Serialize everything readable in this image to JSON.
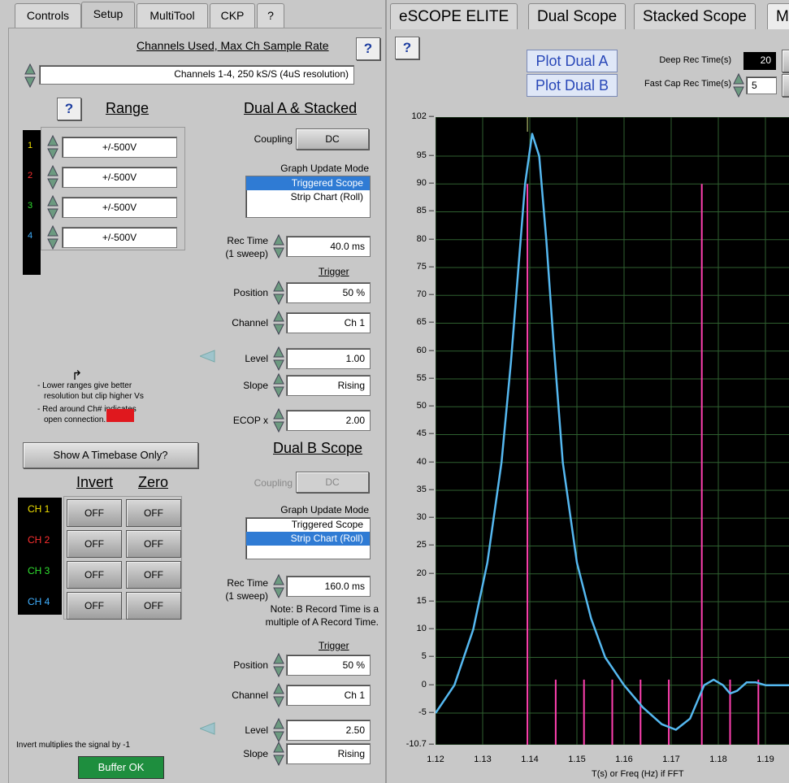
{
  "left_tabs": [
    "Controls",
    "Setup",
    "MultiTool",
    "CKP",
    "?"
  ],
  "right_tabs": [
    "eSCOPE ELITE",
    "Dual Scope",
    "Stacked Scope",
    "M"
  ],
  "channels_used": {
    "title": "Channels Used, Max Ch Sample Rate",
    "value": "Channels 1-4, 250 kS/S (4uS resolution)",
    "help": "?"
  },
  "range": {
    "title": "Range",
    "help": "?",
    "channels": [
      {
        "num": "1",
        "value": "+/-500V",
        "color": "#f0e000"
      },
      {
        "num": "2",
        "value": "+/-500V",
        "color": "#ff3030"
      },
      {
        "num": "3",
        "value": "+/-500V",
        "color": "#30e030"
      },
      {
        "num": "4",
        "value": "+/-500V",
        "color": "#40b0ff"
      }
    ]
  },
  "notes": {
    "line1": "- Lower ranges give better",
    "line2": "  resolution but clip higher Vs",
    "line3": "- Red around Ch# indicates",
    "line4": "  open connection."
  },
  "timebase_button": "Show A Timebase Only?",
  "invert_zero": {
    "invert_title": "Invert",
    "zero_title": "Zero",
    "rows": [
      {
        "label": "CH 1",
        "color": "#f0e000",
        "invert": "OFF",
        "zero": "OFF"
      },
      {
        "label": "CH 2",
        "color": "#ff3030",
        "invert": "OFF",
        "zero": "OFF"
      },
      {
        "label": "CH 3",
        "color": "#30e030",
        "invert": "OFF",
        "zero": "OFF"
      },
      {
        "label": "CH 4",
        "color": "#40b0ff",
        "invert": "OFF",
        "zero": "OFF"
      }
    ]
  },
  "invert_note": "Invert multiplies the signal by -1",
  "buffer_status": "Buffer OK",
  "dual_a": {
    "title": "Dual A & Stacked",
    "coupling_label": "Coupling",
    "coupling": "DC",
    "update_mode_label": "Graph Update Mode",
    "modes": [
      "Triggered Scope",
      "Strip Chart (Roll)"
    ],
    "selected_mode": 0,
    "rec_time_label": "Rec Time",
    "rec_time_sub": "(1 sweep)",
    "rec_time": "40.0 ms",
    "trigger_label": "Trigger",
    "position_label": "Position",
    "position": "50 %",
    "channel_label": "Channel",
    "channel": "Ch 1",
    "level_label": "Level",
    "level": "1.00",
    "slope_label": "Slope",
    "slope": "Rising",
    "ecop_label": "ECOP x",
    "ecop": "2.00"
  },
  "dual_b": {
    "title": "Dual B Scope",
    "coupling_label": "Coupling",
    "coupling": "DC",
    "update_mode_label": "Graph Update Mode",
    "modes": [
      "Triggered Scope",
      "Strip Chart (Roll)"
    ],
    "selected_mode": 1,
    "rec_time_label": "Rec Time",
    "rec_time_sub": "(1 sweep)",
    "rec_time": "160.0 ms",
    "note1": "Note: B Record Time is a",
    "note2": "multiple of A Record Time.",
    "trigger_label": "Trigger",
    "position_label": "Position",
    "position": "50 %",
    "channel_label": "Channel",
    "channel": "Ch 1",
    "level_label": "Level",
    "level": "2.50",
    "slope_label": "Slope",
    "slope": "Rising"
  },
  "right_header": {
    "help": "?",
    "plot_a": "Plot Dual A",
    "plot_b": "Plot Dual B",
    "deep_rec_label": "Deep Rec Time(s)",
    "deep_rec_value": "20",
    "fast_cap_label": "Fast Cap Rec Time(s)",
    "fast_cap_value": "5"
  },
  "chart_data": {
    "type": "line",
    "xlabel": "T(s) or Freq (Hz) if FFT",
    "xlim": [
      1.12,
      1.195
    ],
    "ylim": [
      -10.7,
      102
    ],
    "x_ticks": [
      "1.12",
      "1.13",
      "1.14",
      "1.15",
      "1.16",
      "1.17",
      "1.18",
      "1.19"
    ],
    "y_ticks": [
      "102",
      "95",
      "90",
      "85",
      "80",
      "75",
      "70",
      "65",
      "60",
      "55",
      "50",
      "45",
      "40",
      "35",
      "30",
      "25",
      "20",
      "15",
      "10",
      "5",
      "0",
      "-5",
      "-10.7"
    ],
    "cursor_label": "1",
    "series": [
      {
        "color": "#55b8f0",
        "x": [
          1.12,
          1.124,
          1.128,
          1.131,
          1.134,
          1.136,
          1.1375,
          1.139,
          1.1405,
          1.142,
          1.1435,
          1.145,
          1.147,
          1.15,
          1.153,
          1.156,
          1.16,
          1.164,
          1.168,
          1.171,
          1.174,
          1.177,
          1.179,
          1.181,
          1.1825,
          1.184,
          1.186,
          1.188,
          1.19,
          1.193,
          1.195
        ],
        "y": [
          -5,
          0,
          10,
          22,
          40,
          58,
          74,
          90,
          99,
          95,
          80,
          62,
          40,
          22,
          12,
          5,
          0,
          -4,
          -7,
          -8,
          -6,
          0,
          1,
          0,
          -1.5,
          -1,
          0.5,
          0.5,
          0,
          0,
          0
        ]
      }
    ],
    "markers": {
      "color": "#ff40b0",
      "tall_x": [
        1.1395,
        1.1765
      ],
      "tall_top": 90,
      "short_x": [
        1.1455,
        1.1515,
        1.1575,
        1.1635,
        1.1695,
        1.1825,
        1.1885
      ],
      "short_top": 1
    }
  }
}
